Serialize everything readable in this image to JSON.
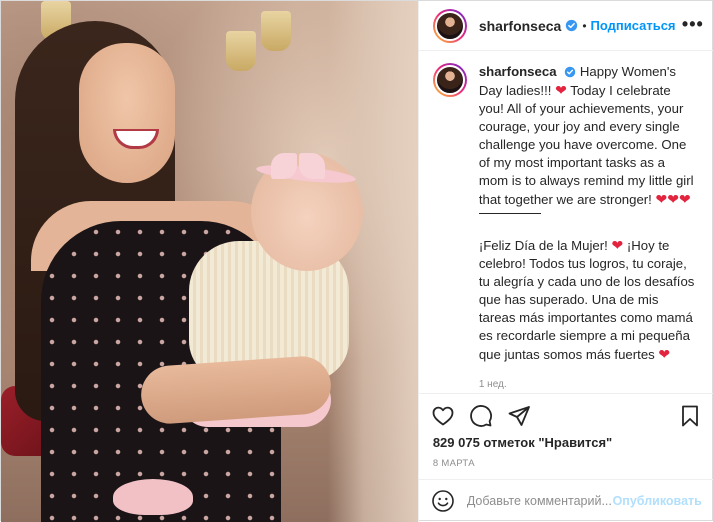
{
  "post": {
    "username": "sharfonseca",
    "follow_label": "Подписаться",
    "separator": "•",
    "more_label": "•••"
  },
  "caption": {
    "username": "sharfonseca",
    "para1": "Happy Women's Day ladies!!! ❤ Today I celebrate you! All of your achievements, your courage, your joy and every single challenge you have overcome. One of my most important tasks as a mom is to always remind my little girl that together we are stronger! ❤❤❤",
    "para2": "¡Feliz Día de la Mujer! ❤ ¡Hoy te celebro! Todos tus logros, tu coraje, tu alegría y cada uno de los desafíos que has superado. Una de mis tareas más importantes como mamá es recordarle siempre a mi pequeña que juntas somos más fuertes ❤",
    "time": "1 нед."
  },
  "stats": {
    "likes": "829 075 отметок \"Нравится\"",
    "date": "8 МАРТА"
  },
  "comment": {
    "placeholder": "Добавьте комментарий...",
    "publish_label": "Опубликовать"
  },
  "icons": {
    "like": "heart-outline-icon",
    "comment": "comment-bubble-icon",
    "share": "paper-plane-icon",
    "save": "bookmark-icon",
    "emoji": "smiley-icon",
    "verified": "verified-badge-icon",
    "more": "more-options-icon"
  },
  "colors": {
    "accent": "#0095f6",
    "verified": "#3897f0",
    "heart": "#e3243f",
    "muted": "#8e8e8e",
    "publish_disabled": "#b2dffc"
  }
}
